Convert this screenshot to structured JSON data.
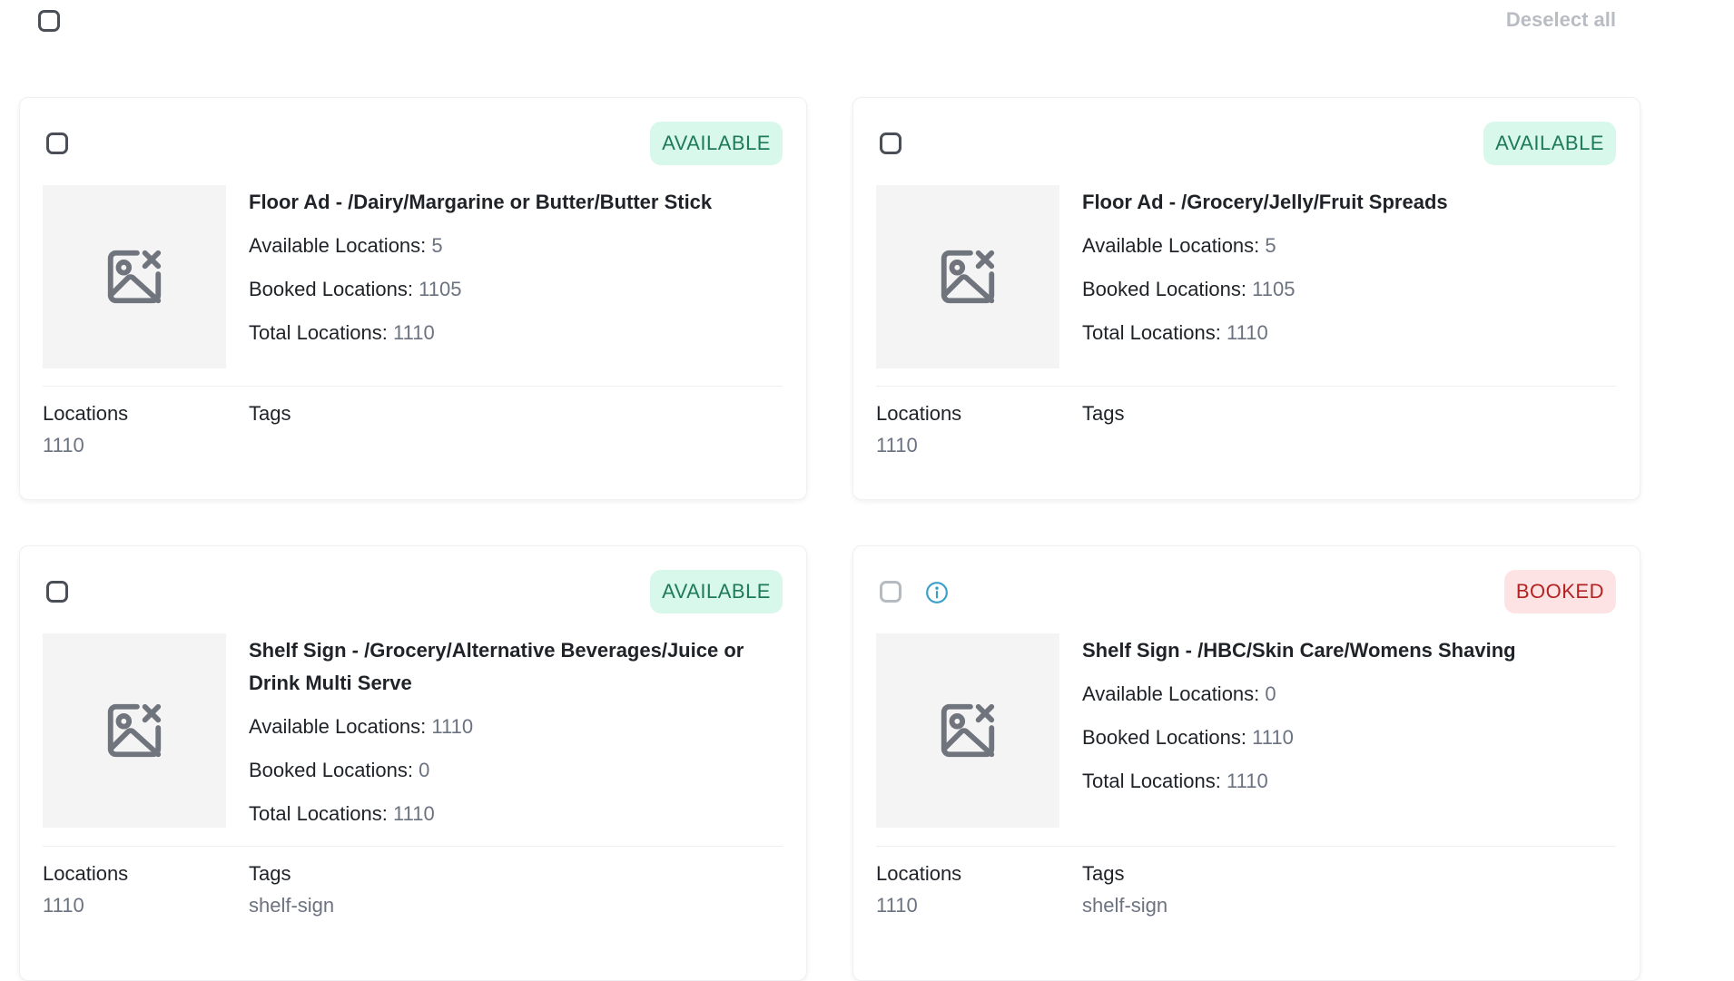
{
  "toolbar": {
    "deselect_label": "Deselect all"
  },
  "colors": {
    "available_bg": "#d9f8ec",
    "available_fg": "#1f7a5c",
    "booked_bg": "#fde3e3",
    "booked_fg": "#b42323",
    "info_icon": "#3aa0c9"
  },
  "cards": [
    {
      "status": "AVAILABLE",
      "title": "Floor Ad - /Dairy/Margarine or Butter/Butter Stick",
      "available_label": "Available Locations:",
      "available_value": "5",
      "booked_label": "Booked Locations:",
      "booked_value": "1105",
      "total_label": "Total Locations:",
      "total_value": "1110",
      "locations_label": "Locations",
      "locations_value": "1110",
      "tags_label": "Tags",
      "tags_value": ""
    },
    {
      "status": "AVAILABLE",
      "title": "Floor Ad - /Grocery/Jelly/Fruit Spreads",
      "available_label": "Available Locations:",
      "available_value": "5",
      "booked_label": "Booked Locations:",
      "booked_value": "1105",
      "total_label": "Total Locations:",
      "total_value": "1110",
      "locations_label": "Locations",
      "locations_value": "1110",
      "tags_label": "Tags",
      "tags_value": ""
    },
    {
      "status": "AVAILABLE",
      "title": "Shelf Sign - /Grocery/Alternative Beverages/Juice or Drink Multi Serve",
      "available_label": "Available Locations:",
      "available_value": "1110",
      "booked_label": "Booked Locations:",
      "booked_value": "0",
      "total_label": "Total Locations:",
      "total_value": "1110",
      "locations_label": "Locations",
      "locations_value": "1110",
      "tags_label": "Tags",
      "tags_value": "shelf-sign"
    },
    {
      "status": "BOOKED",
      "title": "Shelf Sign - /HBC/Skin Care/Womens Shaving",
      "available_label": "Available Locations:",
      "available_value": "0",
      "booked_label": "Booked Locations:",
      "booked_value": "1110",
      "total_label": "Total Locations:",
      "total_value": "1110",
      "locations_label": "Locations",
      "locations_value": "1110",
      "tags_label": "Tags",
      "tags_value": "shelf-sign"
    }
  ]
}
